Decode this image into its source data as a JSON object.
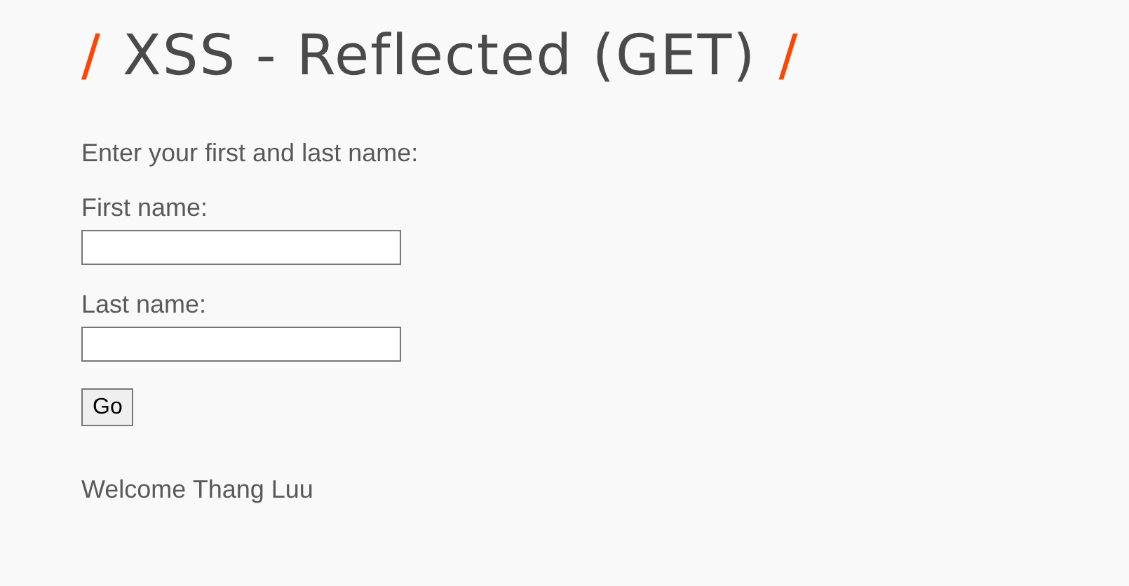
{
  "heading": {
    "mark_left": "/",
    "title": "XSS - Reflected (GET)",
    "mark_right": "/"
  },
  "intro": "Enter your first and last name:",
  "fields": [
    {
      "label": "First name:"
    },
    {
      "label": "Last name:"
    }
  ],
  "button": "Go",
  "message": "Welcome Thang Luu"
}
